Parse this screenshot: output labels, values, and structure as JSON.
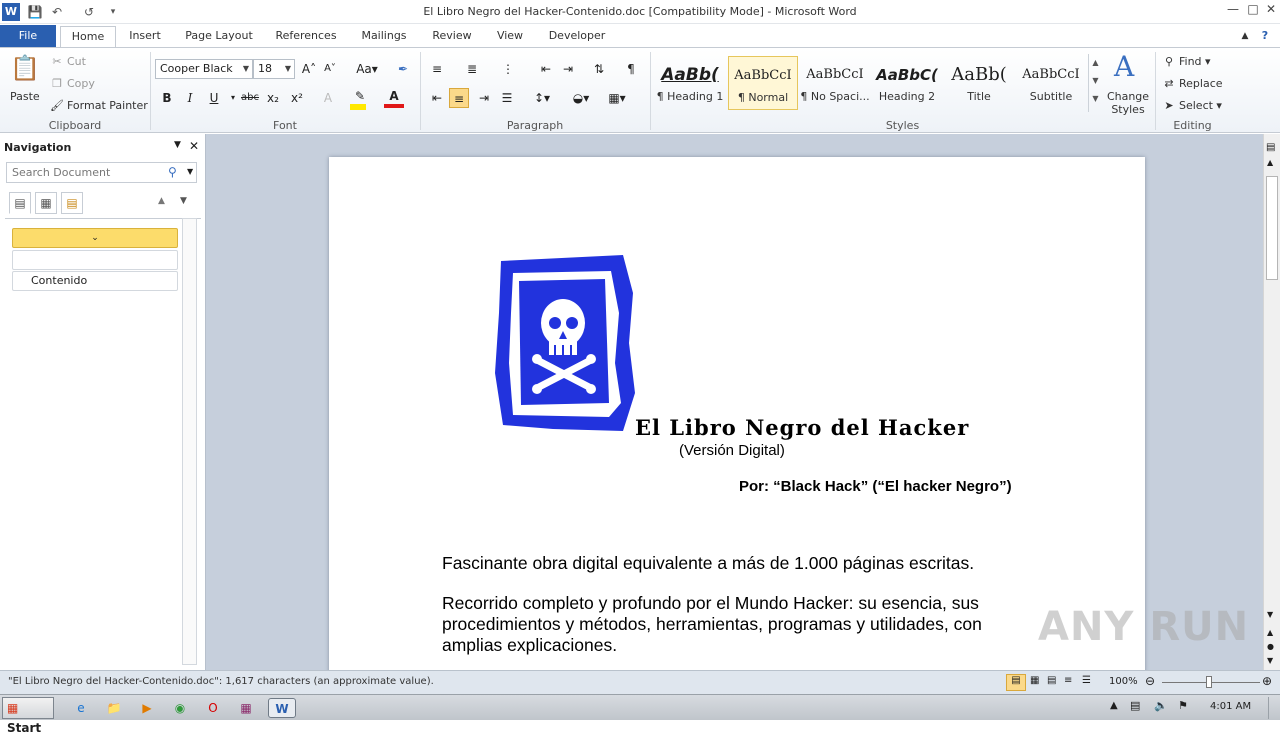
{
  "window": {
    "title": "El Libro Negro del Hacker-Contenido.doc [Compatibility Mode]  -  Microsoft Word"
  },
  "tabs": [
    "File",
    "Home",
    "Insert",
    "Page Layout",
    "References",
    "Mailings",
    "Review",
    "View",
    "Developer"
  ],
  "ribbon": {
    "clipboard": {
      "paste": "Paste",
      "cut": "Cut",
      "copy": "Copy",
      "format_painter": "Format Painter",
      "label": "Clipboard"
    },
    "font": {
      "name": "Cooper Black",
      "size": "18",
      "label": "Font",
      "bold": "B",
      "italic": "I",
      "underline": "U",
      "strike": "abc",
      "sub": "x₂",
      "sup": "x²"
    },
    "paragraph": {
      "label": "Paragraph"
    },
    "styles": {
      "label": "Styles",
      "items": [
        {
          "sample": "AaBb(",
          "name": "¶ Heading 1"
        },
        {
          "sample": "AaBbCcI",
          "name": "¶ Normal"
        },
        {
          "sample": "AaBbCcI",
          "name": "¶ No Spaci..."
        },
        {
          "sample": "AaBbC(",
          "name": "Heading 2"
        },
        {
          "sample": "AaBb(",
          "name": "Title"
        },
        {
          "sample": "AaBbCcI",
          "name": "Subtitle"
        }
      ],
      "change_styles": "Change Styles"
    },
    "editing": {
      "label": "Editing",
      "find": "Find",
      "replace": "Replace",
      "select": "Select"
    }
  },
  "navigation": {
    "title": "Navigation",
    "search_placeholder": "Search Document",
    "items": [
      "",
      "",
      "Contenido"
    ]
  },
  "document": {
    "title": "El Libro Negro del Hacker",
    "subtitle": "(Versión Digital)",
    "author": "Por: “Black Hack” (“El hacker Negro”)",
    "para1": "Fascinante obra digital equivalente a más de 1.000 páginas escritas.",
    "para2": "Recorrido completo y profundo por el Mundo Hacker: su esencia, sus procedimientos y métodos, herramientas, programas y utilidades, con amplias explicaciones."
  },
  "statusbar": {
    "text": "\"El Libro Negro del Hacker-Contenido.doc\": 1,617 characters (an approximate value).",
    "zoom": "100%"
  },
  "taskbar": {
    "start": "Start",
    "clock": "4:01 AM"
  },
  "watermark": "ANY RUN",
  "colors": {
    "file_tab": "#2a5fb0",
    "logo_blue": "#1f2fd6",
    "selected_style": "#fff7d6"
  }
}
